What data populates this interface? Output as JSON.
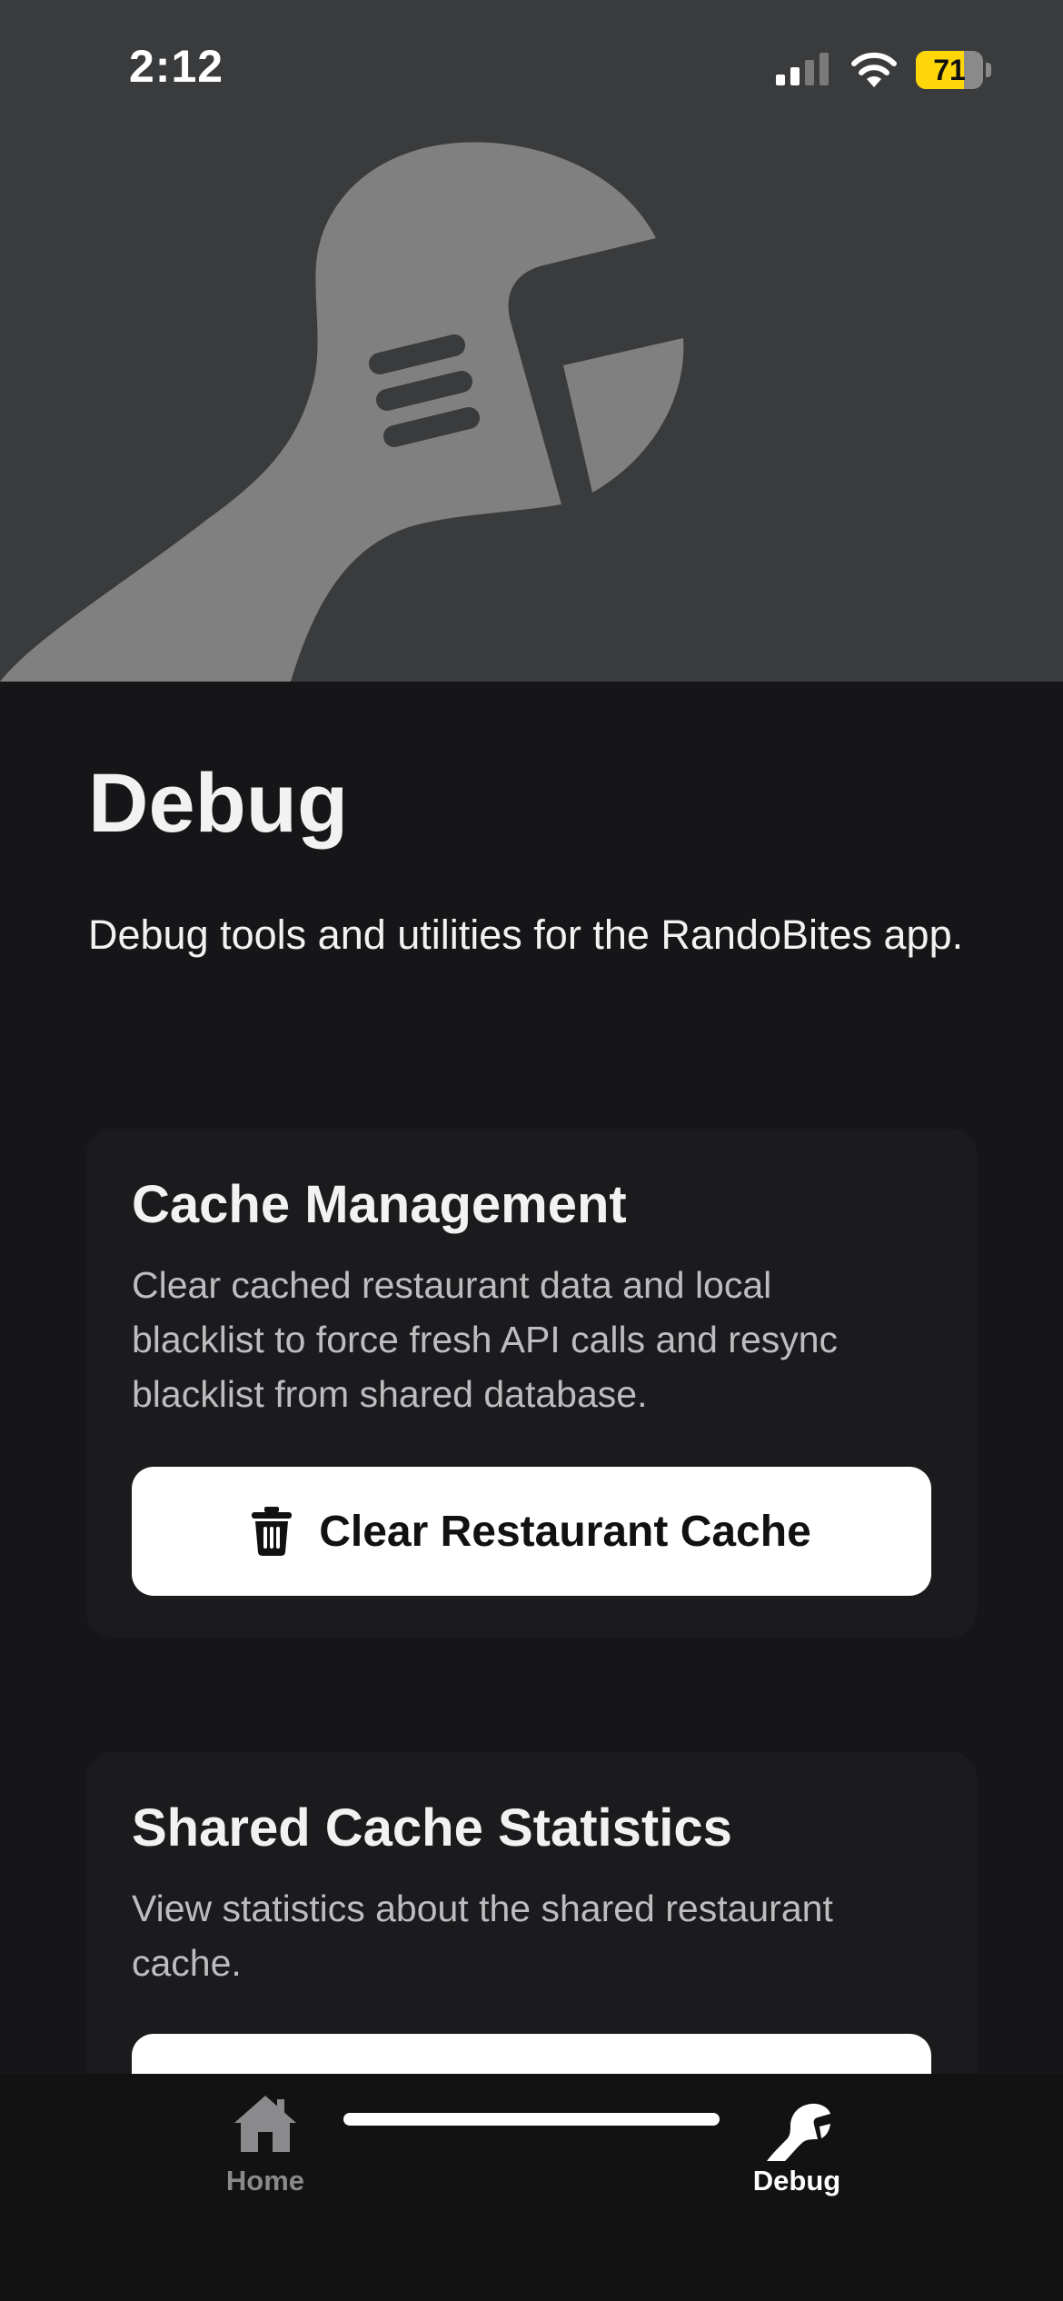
{
  "status_bar": {
    "time": "2:12",
    "battery": {
      "level": 71,
      "label": "71",
      "fill_color": "#ffd60a"
    },
    "signal": {
      "bars_filled": 2,
      "bars_total": 4
    },
    "wifi_icon": "wifi-icon"
  },
  "hero": {
    "icon": "wrench-icon",
    "background_color": "#3a3b3c",
    "icon_color": "#808080"
  },
  "page": {
    "title": "Debug",
    "subtitle": "Debug tools and utilities for the RandoBites app."
  },
  "sections": {
    "cache_management": {
      "title": "Cache Management",
      "description": "Clear cached restaurant data and local blacklist to force fresh API calls and resync blacklist from shared database.",
      "button_label": "Clear Restaurant Cache",
      "button_icon": "trash-icon"
    },
    "shared_cache_stats": {
      "title": "Shared Cache Statistics",
      "description": "View statistics about the shared restaurant cache."
    }
  },
  "tab_bar": {
    "home": {
      "label": "Home",
      "icon": "house-icon",
      "color": "#8a8a8c"
    },
    "debug": {
      "label": "Debug",
      "icon": "wrench-icon",
      "color": "#ffffff",
      "selected": true
    }
  },
  "colors": {
    "background": "#161618",
    "card": "#1b1b1d",
    "button": "#ffffff",
    "tab_bar": "#121212"
  }
}
